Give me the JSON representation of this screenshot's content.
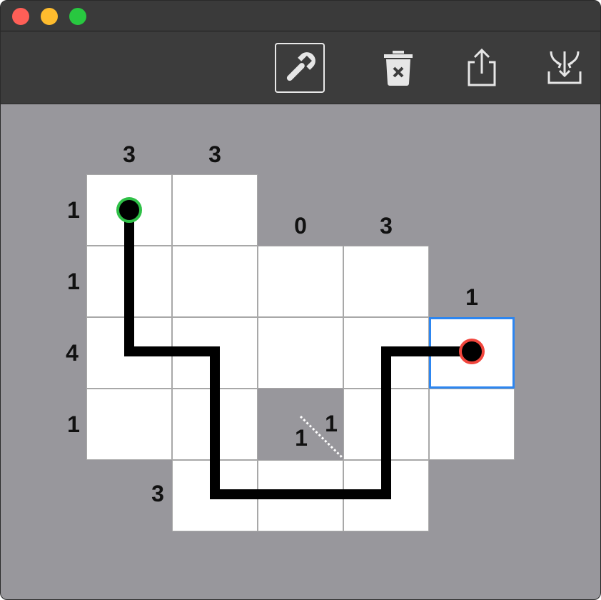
{
  "toolbar": {
    "tools": [
      {
        "name": "wrench-icon",
        "active": true
      },
      {
        "name": "trash-icon",
        "active": false
      },
      {
        "name": "share-icon",
        "active": false
      },
      {
        "name": "merge-down-icon",
        "active": false
      }
    ]
  },
  "puzzle": {
    "column_clues": [
      "3",
      "3",
      "0",
      "3",
      "1"
    ],
    "row_clues": [
      "1",
      "1",
      "4",
      "1",
      "3"
    ],
    "hole_clues": [
      "1",
      "1"
    ],
    "start_marker": "start",
    "end_marker": "end",
    "colors": {
      "start_ring": "#2fc047",
      "end_ring": "#f1463d",
      "selection": "#2d86f0",
      "path": "#000000"
    }
  }
}
